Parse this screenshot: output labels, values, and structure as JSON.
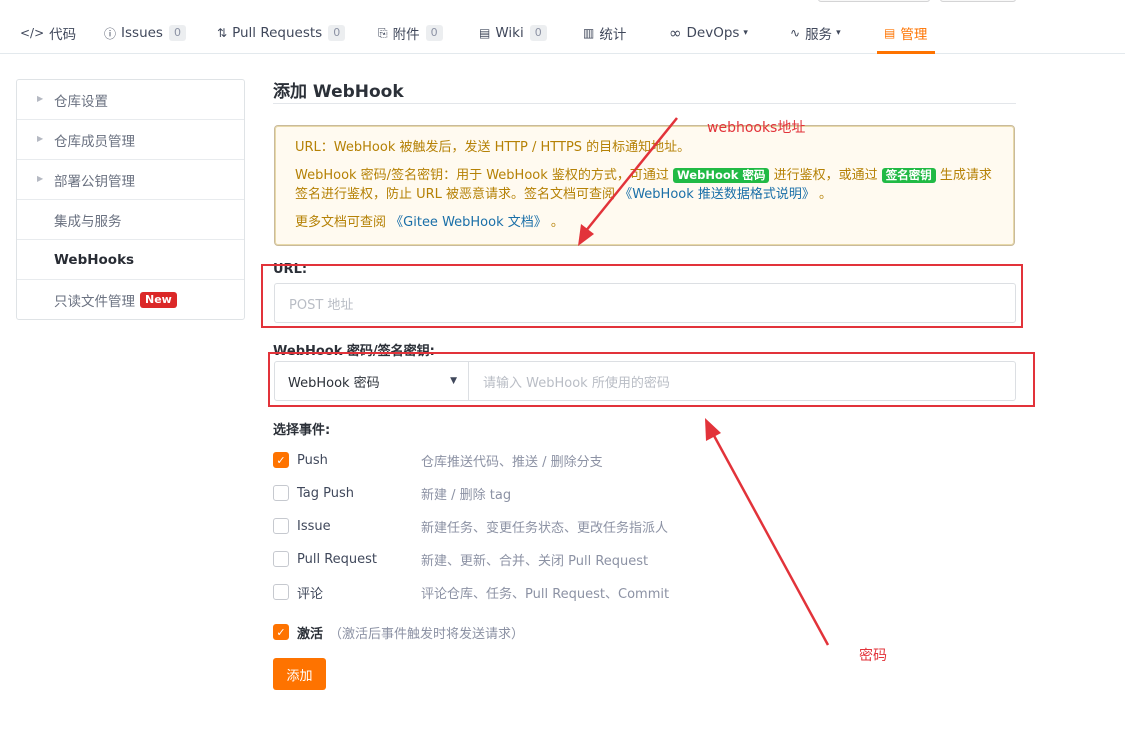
{
  "nav": {
    "tabs": [
      {
        "icon": "</>",
        "label": "代码"
      },
      {
        "icon": "ⓘ",
        "label": "Issues",
        "count": "0"
      },
      {
        "icon": "⇅",
        "label": "Pull Requests",
        "count": "0"
      },
      {
        "icon": "⎘",
        "label": "附件",
        "count": "0"
      },
      {
        "icon": "▤",
        "label": "Wiki",
        "count": "0"
      },
      {
        "icon": "▥",
        "label": "统计"
      },
      {
        "icon": "∞",
        "label": "DevOps",
        "caret": "▾"
      },
      {
        "icon": "∿",
        "label": "服务",
        "caret": "▾"
      },
      {
        "icon": "▤",
        "label": "管理"
      }
    ]
  },
  "sidebar": {
    "items": [
      {
        "label": "仓库设置"
      },
      {
        "label": "仓库成员管理"
      },
      {
        "label": "部署公钥管理"
      },
      {
        "label": "集成与服务"
      },
      {
        "label": "WebHooks"
      },
      {
        "label": "只读文件管理",
        "badge": "New"
      }
    ]
  },
  "main": {
    "title": "添加 WebHook",
    "notice": {
      "line1": "URL：WebHook 被触发后，发送 HTTP / HTTPS 的目标通知地址。",
      "line2a": "WebHook 密码/签名密钥：用于 WebHook 鉴权的方式，可通过",
      "tag_password": "WebHook 密码",
      "line2b": "进行鉴权，或通过",
      "tag_sign": "签名密钥",
      "line2c": "生成请求签名进行鉴权，防止 URL 被恶意请求。签名文档可查阅",
      "link_push": "《WebHook 推送数据格式说明》",
      "line2d": "。",
      "line3a": "更多文档可查阅",
      "link_docs": "《Gitee WebHook 文档》",
      "line3b": "。"
    },
    "url_label": "URL:",
    "url_placeholder": "POST 地址",
    "secret_label": "WebHook 密码/签名密钥:",
    "secret_type": "WebHook 密码",
    "secret_placeholder": "请输入 WebHook 所使用的密码",
    "events_label": "选择事件:",
    "events": [
      {
        "name": "Push",
        "desc": "仓库推送代码、推送 / 删除分支",
        "checked": true
      },
      {
        "name": "Tag Push",
        "desc": "新建 / 删除 tag",
        "checked": false
      },
      {
        "name": "Issue",
        "desc": "新建任务、变更任务状态、更改任务指派人",
        "checked": false
      },
      {
        "name": "Pull Request",
        "desc": "新建、更新、合并、关闭 Pull Request",
        "checked": false
      },
      {
        "name": "评论",
        "desc": "评论仓库、任务、Pull Request、Commit",
        "checked": false
      }
    ],
    "active_label": "激活",
    "active_hint": "（激活后事件触发时将发送请求）",
    "submit_label": "添加"
  },
  "annotations": {
    "webhook_url_note": "webhooks地址",
    "password_note": "密码"
  },
  "colors": {
    "accent": "#fe7300",
    "annotation_red": "#e2333a",
    "notice_text": "#b58105",
    "tag_green": "#21ba45",
    "badge_red": "#db2828"
  }
}
